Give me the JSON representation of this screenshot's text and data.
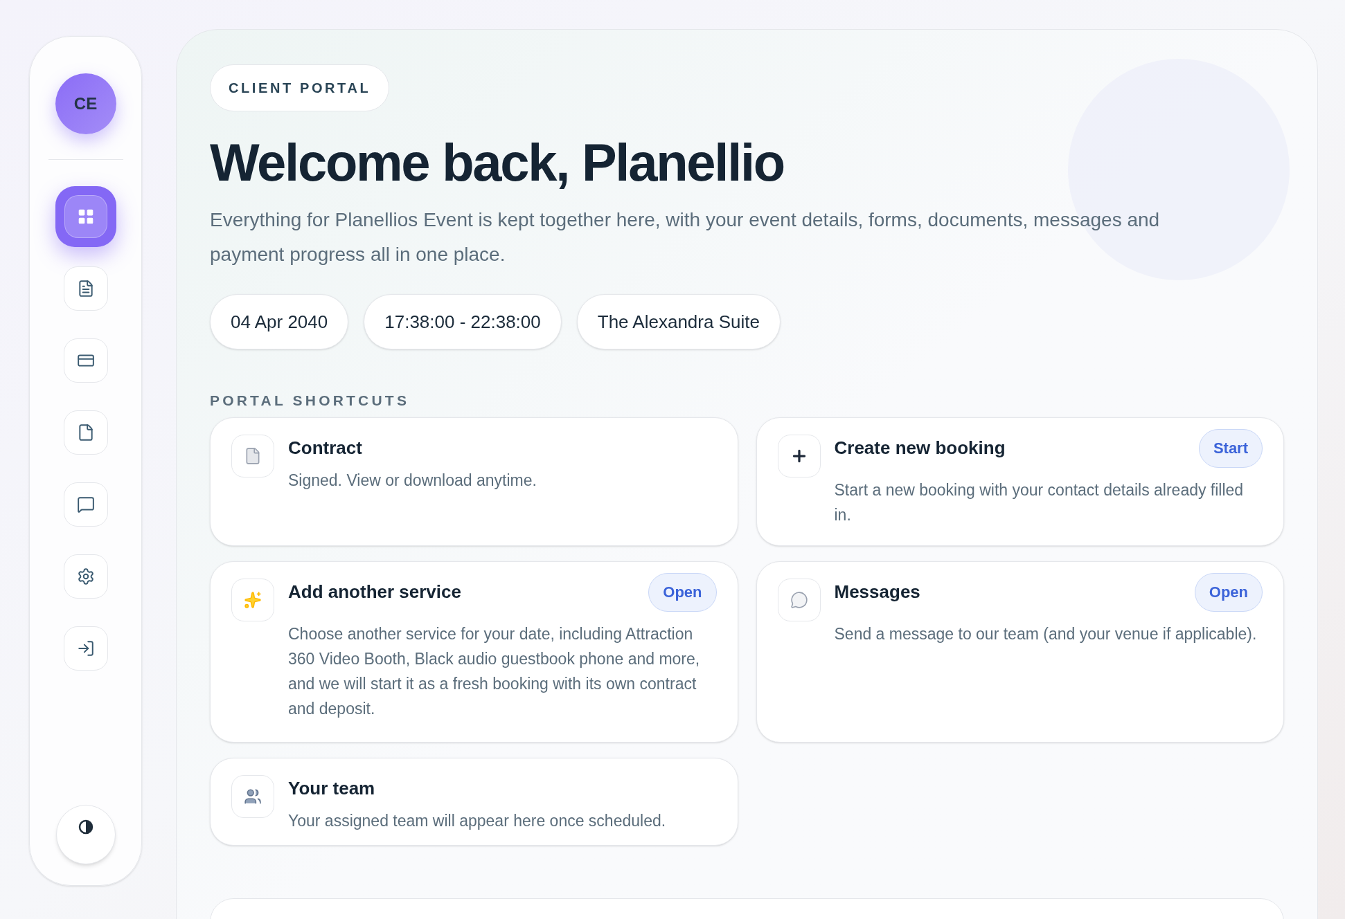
{
  "sidebar": {
    "avatar": "CE",
    "nav": [
      {
        "selected": true
      },
      {
        "selected": false
      },
      {
        "selected": false
      },
      {
        "selected": false
      },
      {
        "selected": false
      },
      {
        "selected": false
      },
      {
        "selected": false
      }
    ]
  },
  "header": {
    "badge": "CLIENT PORTAL",
    "title": "Welcome back, Planellio",
    "subtitle": "Everything for Planellios Event is kept together here, with your event details, forms, documents, messages and payment progress all in one place.",
    "chips": [
      "04 Apr 2040",
      "17:38:00 - 22:38:00",
      "The Alexandra Suite"
    ]
  },
  "shortcuts": {
    "heading": "PORTAL SHORTCUTS",
    "cards": [
      {
        "title": "Contract",
        "description": "Signed. View or download anytime."
      },
      {
        "title": "Create new booking",
        "description": "Start a new booking with your contact details already filled in.",
        "action": "Start"
      },
      {
        "title": "Add another service",
        "description": "Choose another service for your date, including Attraction 360 Video Booth, Black audio guestbook phone and more, and we will start it as a fresh booking with its own contract and deposit.",
        "action": "Open"
      },
      {
        "title": "Messages",
        "description": "Send a message to our team (and your venue if applicable).",
        "action": "Open"
      },
      {
        "title": "Your team",
        "description": "Your assigned team will appear here once scheduled."
      }
    ]
  }
}
